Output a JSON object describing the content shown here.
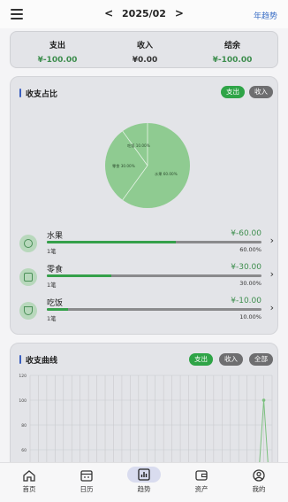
{
  "header": {
    "prev": "<",
    "month": "2025/02",
    "next": ">",
    "year_trend": "年趋势"
  },
  "summary": {
    "expense_label": "支出",
    "expense_value": "¥-100.00",
    "income_label": "收入",
    "income_value": "¥0.00",
    "balance_label": "结余",
    "balance_value": "¥-100.00"
  },
  "ratio": {
    "title": "收支占比",
    "tab_expense": "支出",
    "tab_income": "收入",
    "pie_labels": [
      "水果 60.00%",
      "零食 30.00%",
      "吃饭 10.00%"
    ],
    "categories": [
      {
        "name": "水果",
        "amount": "¥-60.00",
        "count": "1笔",
        "percent": "60.00%",
        "fraction": 0.6
      },
      {
        "name": "零食",
        "amount": "¥-30.00",
        "count": "1笔",
        "percent": "30.00%",
        "fraction": 0.3
      },
      {
        "name": "吃饭",
        "amount": "¥-10.00",
        "count": "1笔",
        "percent": "10.00%",
        "fraction": 0.1
      }
    ]
  },
  "curve": {
    "title": "收支曲线",
    "tab_expense": "支出",
    "tab_income": "收入",
    "tab_all": "全部"
  },
  "chart_data": {
    "type": "line",
    "y_ticks": [
      "120",
      "100",
      "80",
      "60"
    ],
    "ylim": [
      40,
      120
    ],
    "grid": true,
    "series": [
      {
        "values": [
          0,
          0,
          0,
          0,
          0,
          0,
          0,
          0,
          0,
          0,
          0,
          0,
          0,
          0,
          0,
          0,
          0,
          0,
          0,
          0,
          0,
          0,
          0,
          0,
          0,
          0,
          0,
          0,
          100,
          0
        ]
      }
    ]
  },
  "nav": {
    "home": "首页",
    "calendar": "日历",
    "trend": "趋势",
    "assets": "资产",
    "mine": "我的"
  },
  "colors": {
    "accent_green": "#2fa447",
    "pie_green": "#8fcb91",
    "nav_blue": "#3b6fc6"
  }
}
